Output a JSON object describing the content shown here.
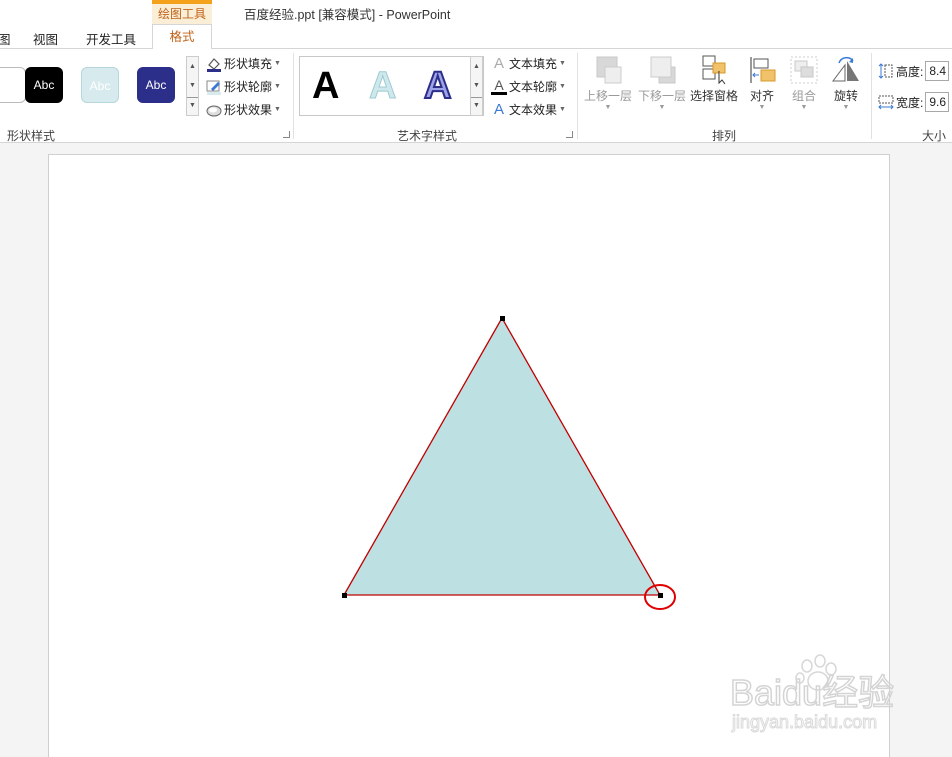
{
  "title_bar": {
    "context_tab_label": "绘图工具",
    "document_title": "百度经验.ppt [兼容模式] - PowerPoint"
  },
  "tabs": {
    "partial_left": "图",
    "view": "视图",
    "developer": "开发工具",
    "active": "格式"
  },
  "ribbon": {
    "shape_styles": {
      "label": "形状样式",
      "swatches": [
        {
          "text": "Abc",
          "bg": "#000000",
          "fg": "#ffffff"
        },
        {
          "text": "Abc",
          "bg": "#d7ebee",
          "fg": "#ffffff"
        },
        {
          "text": "Abc",
          "bg": "#2b2f8a",
          "fg": "#ffffff"
        }
      ],
      "fill": "形状填充",
      "outline": "形状轮廓",
      "effects": "形状效果"
    },
    "wordart_styles": {
      "label": "艺术字样式",
      "samples": [
        "A",
        "A",
        "A"
      ],
      "text_fill": "文本填充",
      "text_outline": "文本轮廓",
      "text_effects": "文本效果"
    },
    "arrange": {
      "label": "排列",
      "bring_forward": "上移一层",
      "send_backward": "下移一层",
      "selection_pane": "选择窗格",
      "align": "对齐",
      "group": "组合",
      "rotate": "旋转"
    },
    "size": {
      "label": "大小",
      "height_label": "高度:",
      "height_value": "8.4",
      "width_label": "宽度:",
      "width_value": "9.6"
    }
  },
  "colors": {
    "accent": "#c0621a",
    "context_tab_bg": "#fbeed6",
    "context_tab_border": "#f4a21c",
    "triangle_fill": "#bde0e3",
    "triangle_outline": "#c00000",
    "highlight_circle": "#e00000"
  },
  "watermark": {
    "brand": "Baidu经验",
    "url": "jingyan.baidu.com"
  }
}
